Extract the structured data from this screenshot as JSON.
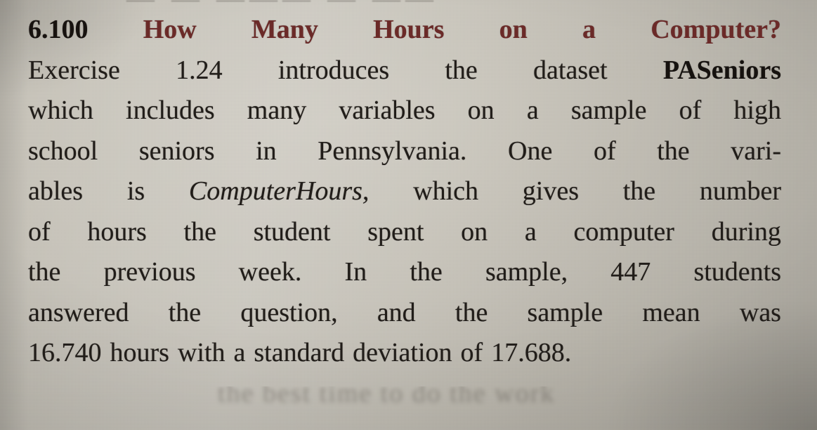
{
  "page": {
    "medium": "textbook-page-photograph",
    "background_color": "#c4c0b6",
    "body_text_color": "#211d19",
    "title_accent_color": "#6b2a28"
  },
  "exercise": {
    "number": "6.100",
    "title_words": [
      "How",
      "Many",
      "Hours",
      "on",
      "a",
      "Computer?"
    ],
    "title_full": "How Many Hours on a Computer?"
  },
  "body": {
    "full_text": "Exercise 1.24 introduces the dataset PASeniors which includes many variables on a sample of high school seniors in Pennsylvania. One of the variables is ComputerHours, which gives the number of hours the student spent on a computer during the previous week. In the sample, 447 students answered the question, and the sample mean was 16.740 hours with a standard deviation of 17.688.",
    "lines": [
      {
        "id": "l1",
        "words": [
          "Exercise",
          "1.24",
          "introduces",
          "the",
          "dataset",
          "PASeniors"
        ],
        "emphasis": {
          "PASeniors": "bold"
        }
      },
      {
        "id": "l2",
        "words": [
          "which",
          "includes",
          "many",
          "variables",
          "on",
          "a",
          "sample",
          "of",
          "high"
        ]
      },
      {
        "id": "l3",
        "words": [
          "school",
          "seniors",
          "in",
          "Pennsylvania.",
          "One",
          "of",
          "the",
          "vari-"
        ]
      },
      {
        "id": "l4",
        "words": [
          "ables",
          "is",
          "ComputerHours,",
          "which",
          "gives",
          "the",
          "number"
        ],
        "emphasis": {
          "ComputerHours,": "italic"
        }
      },
      {
        "id": "l5",
        "words": [
          "of",
          "hours",
          "the",
          "student",
          "spent",
          "on",
          "a",
          "computer",
          "during"
        ]
      },
      {
        "id": "l6",
        "words": [
          "the",
          "previous",
          "week.",
          "In",
          "the",
          "sample,",
          "447",
          "students"
        ]
      },
      {
        "id": "l7",
        "words": [
          "answered",
          "the",
          "question,",
          "and",
          "the",
          "sample",
          "mean",
          "was"
        ]
      },
      {
        "id": "l8",
        "words": [
          "16.740",
          "hours",
          "with",
          "a",
          "standard",
          "deviation",
          "of",
          "17.688."
        ]
      }
    ]
  },
  "referenced": {
    "dataset_name": "PASeniors",
    "variable_name": "ComputerHours",
    "cross_reference": "Exercise 1.24",
    "sample_size": "447",
    "sample_mean": "16.740",
    "standard_deviation": "17.688",
    "units": "hours",
    "time_period": "the previous week",
    "population": "high school seniors in Pennsylvania"
  },
  "artifacts": {
    "top_partial_line": "— —  ———  — ——",
    "bottom_blurred_line": "the  best  time  to  do  the  work"
  }
}
